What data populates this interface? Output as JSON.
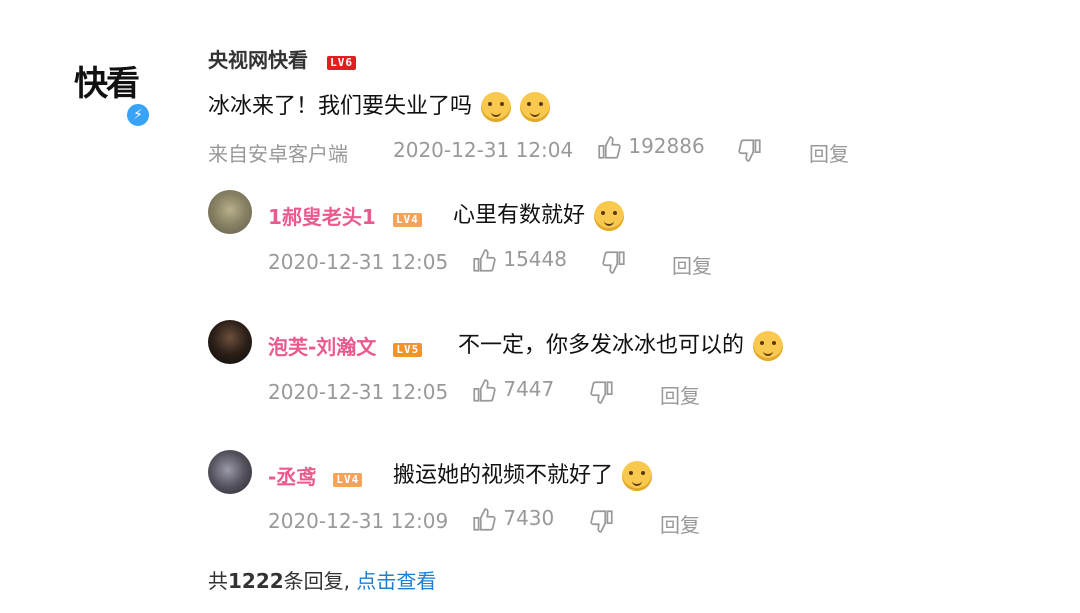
{
  "main_comment": {
    "avatar_text": "快看",
    "username": "央视网快看",
    "level": "LV6",
    "text": "冰冰来了！我们要失业了吗",
    "source": "来自安卓客户端",
    "timestamp": "2020-12-31 12:04",
    "likes": "192886",
    "reply_label": "回复"
  },
  "replies": [
    {
      "username": "1郝叟老头1",
      "level": "LV4",
      "text": "心里有数就好",
      "timestamp": "2020-12-31 12:05",
      "likes": "15448",
      "reply_label": "回复"
    },
    {
      "username": "泡芙-刘瀚文",
      "level": "LV5",
      "text": "不一定，你多发冰冰也可以的",
      "timestamp": "2020-12-31 12:05",
      "likes": "7447",
      "reply_label": "回复"
    },
    {
      "username": "-丞鸢",
      "level": "LV4",
      "text": "搬运她的视频不就好了",
      "timestamp": "2020-12-31 12:09",
      "likes": "7430",
      "reply_label": "回复"
    }
  ],
  "footer": {
    "prefix": "共",
    "count": "1222",
    "suffix": "条回复,",
    "view_link": "点击查看"
  },
  "colors": {
    "level_high": "#e02020",
    "level_low": "#f5a25a",
    "username_pink": "#ea5a8f",
    "meta_gray": "#999999",
    "link_blue": "#1f7ecf"
  },
  "icons": [
    "lightning-verified-icon",
    "thumbs-up-icon",
    "thumbs-down-icon",
    "doge-emoji-icon",
    "smile-emoji-icon"
  ]
}
